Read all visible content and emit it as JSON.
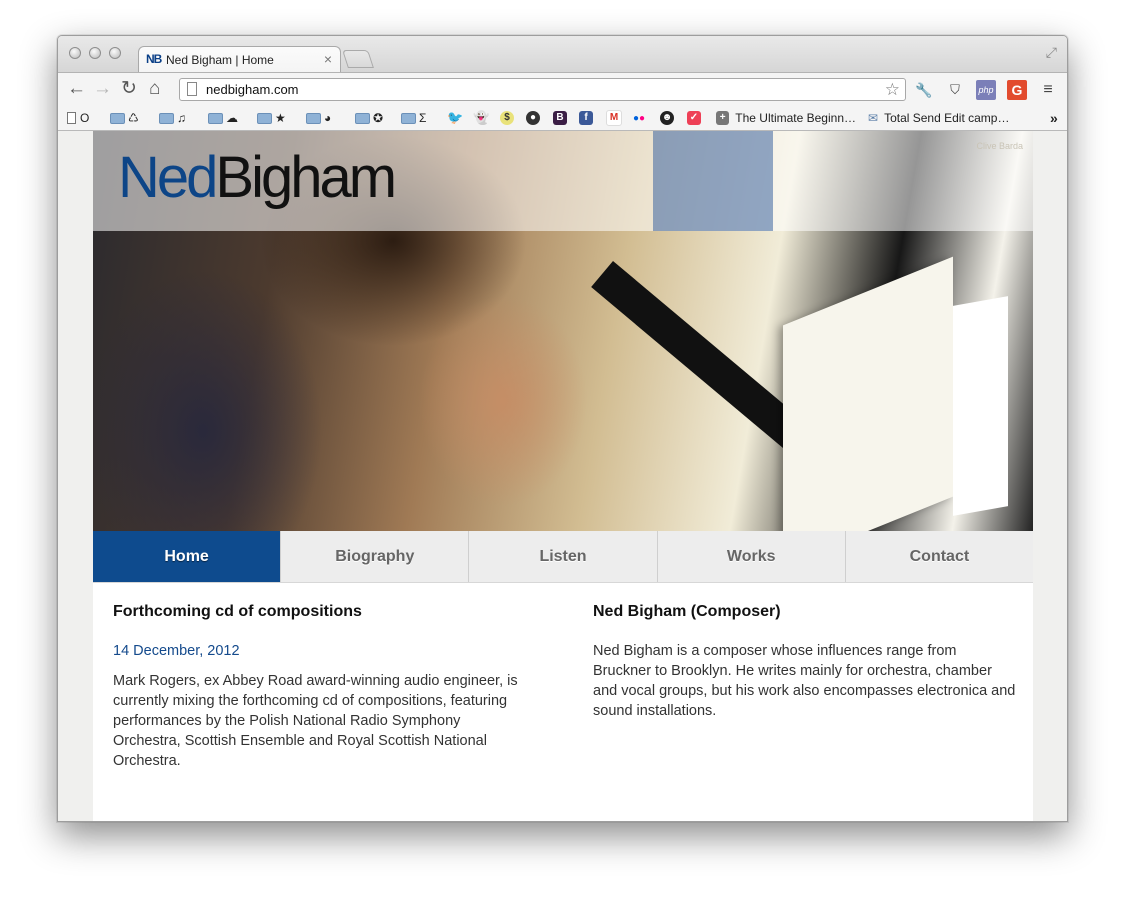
{
  "browser": {
    "tab": {
      "favicon": "NB",
      "title": "Ned Bigham | Home",
      "close_icon": "close-icon"
    },
    "url": "nedbigham.com",
    "bookmarks": [
      {
        "label": "O",
        "icon": "page-icon"
      },
      {
        "label": "♺",
        "icon": "folder-icon"
      },
      {
        "label": "♫",
        "icon": "folder-icon"
      },
      {
        "label": "☁",
        "icon": "folder-icon"
      },
      {
        "label": "★",
        "icon": "folder-icon"
      },
      {
        "label": "◕",
        "icon": "folder-icon"
      },
      {
        "label": "✪",
        "icon": "folder-icon"
      },
      {
        "label": "Σ",
        "icon": "folder-icon"
      },
      {
        "label": "The Ultimate Beginn…",
        "icon": "plus-icon"
      },
      {
        "label": "Total Send Edit camp…",
        "icon": "mail-icon"
      }
    ],
    "bookmarks_more": "»"
  },
  "site": {
    "logo": {
      "first": "Ned",
      "second": "Bigham"
    },
    "photo_credit": "Clive Barda",
    "nav": [
      {
        "label": "Home",
        "active": true
      },
      {
        "label": "Biography",
        "active": false
      },
      {
        "label": "Listen",
        "active": false
      },
      {
        "label": "Works",
        "active": false
      },
      {
        "label": "Contact",
        "active": false
      }
    ],
    "news": {
      "heading": "Forthcoming cd of compositions",
      "date": "14 December, 2012",
      "body": "Mark Rogers, ex Abbey Road award-winning audio engineer, is currently mixing the forthcoming cd of compositions, featuring performances by the Polish National Radio Symphony Orchestra, Scottish Ensemble and Royal Scottish National Orchestra."
    },
    "about": {
      "heading": "Ned Bigham (Composer)",
      "body": "Ned Bigham is a composer whose influences range from Bruckner to Brooklyn. He writes mainly for orchestra, chamber and vocal groups, but his work also encompasses electronica and sound installations."
    }
  },
  "colors": {
    "brand_blue": "#0e4b8e",
    "nav_bg": "#ededed"
  }
}
